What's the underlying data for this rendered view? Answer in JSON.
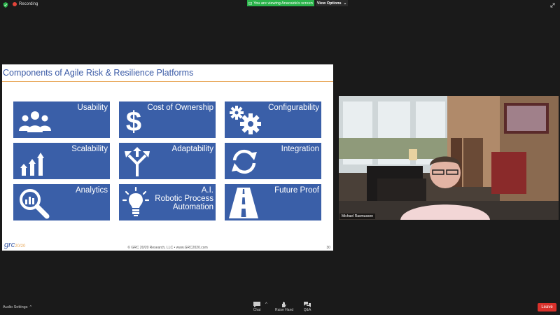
{
  "topbar": {
    "recording_label": "Recording",
    "viewing_label": "You are viewing Anacaida's screen",
    "view_options_label": "View Options",
    "green": "#2ab34a"
  },
  "slide": {
    "title": "Components of Agile Risk & Resilience Platforms",
    "tiles": [
      {
        "label": "Usability",
        "icon": "users-icon"
      },
      {
        "label": "Cost of Ownership",
        "icon": "dollar-icon"
      },
      {
        "label": "Configurability",
        "icon": "gears-icon"
      },
      {
        "label": "Scalability",
        "icon": "bars-growth-icon"
      },
      {
        "label": "Adaptability",
        "icon": "arrows-split-icon"
      },
      {
        "label": "Integration",
        "icon": "sync-icon"
      },
      {
        "label": "Analytics",
        "icon": "magnifier-chart-icon"
      },
      {
        "label": "A.I.\nRobotic Process\nAutomation",
        "icon": "lightbulb-icon"
      },
      {
        "label": "Future Proof",
        "icon": "road-icon"
      }
    ],
    "logo_text": "grc",
    "logo_suffix": "20/20",
    "copyright": "© GRC 20/20 Research, LLC  •  www.GRC2020.com",
    "page_number": "30",
    "tile_color": "#3a5fa8",
    "title_color": "#3a5aa6"
  },
  "video": {
    "participant_name": "Michael Rasmussen"
  },
  "bottombar": {
    "audio_settings": "Audio Settings",
    "chat": "Chat",
    "raise_hand": "Raise Hand",
    "qa": "Q&A",
    "leave": "Leave"
  }
}
